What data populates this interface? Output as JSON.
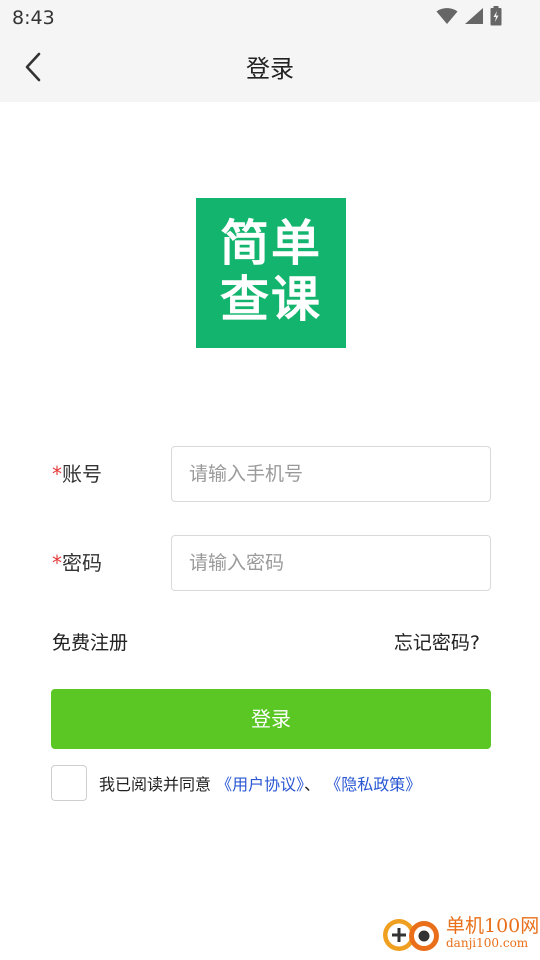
{
  "status_bar": {
    "time": "8:43",
    "icons": [
      "wifi-icon",
      "signal-icon",
      "battery-charging-icon"
    ]
  },
  "app_bar": {
    "back_icon": "chevron-left-icon",
    "title": "登录"
  },
  "logo": {
    "line1": "简单",
    "line2": "查课",
    "color": "#13b46e"
  },
  "form": {
    "account": {
      "required_mark": "*",
      "label": "账号",
      "placeholder": "请输入手机号",
      "value": ""
    },
    "password": {
      "required_mark": "*",
      "label": "密码",
      "placeholder": "请输入密码",
      "value": ""
    }
  },
  "links": {
    "register": "免费注册",
    "forgot_password": "忘记密码?"
  },
  "login_button": {
    "label": "登录",
    "color": "#5ac725"
  },
  "agreement": {
    "checked": false,
    "prefix": "我已阅读并同意",
    "user_agreement": "《用户协议》",
    "separator": "、",
    "privacy_policy": "《隐私政策》",
    "link_color": "#2a57d4"
  },
  "watermark": {
    "brand": "单机100网",
    "domain": "danji100.com",
    "color": "#e96f1a"
  }
}
